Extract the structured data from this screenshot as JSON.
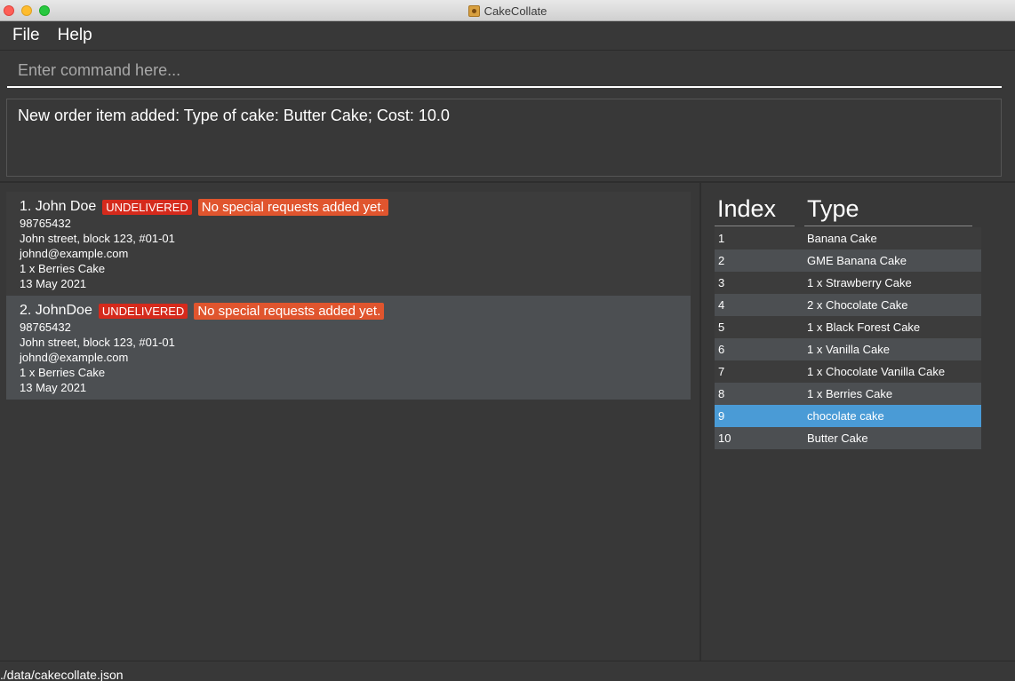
{
  "window": {
    "title": "CakeCollate"
  },
  "menu": {
    "file": "File",
    "help": "Help"
  },
  "command": {
    "placeholder": "Enter command here..."
  },
  "result": {
    "message": "New order item added: Type of cake: Butter Cake; Cost: 10.0"
  },
  "orders": [
    {
      "name": "1.  John Doe",
      "status": "UNDELIVERED",
      "request": "No special requests added yet.",
      "phone": "98765432",
      "address": "John street, block 123, #01-01",
      "email": "johnd@example.com",
      "items": "1 x Berries Cake",
      "date": "13 May 2021"
    },
    {
      "name": "2.  JohnDoe",
      "status": "UNDELIVERED",
      "request": "No special requests added yet.",
      "phone": "98765432",
      "address": "John street, block 123, #01-01",
      "email": "johnd@example.com",
      "items": "1 x Berries Cake",
      "date": "13 May 2021"
    }
  ],
  "order_items": {
    "headers": {
      "index": "Index",
      "type": "Type"
    },
    "selected_index": 8,
    "rows": [
      {
        "index": "1",
        "type": "Banana Cake"
      },
      {
        "index": "2",
        "type": "GME Banana Cake"
      },
      {
        "index": "3",
        "type": "1 x Strawberry Cake"
      },
      {
        "index": "4",
        "type": "2 x Chocolate Cake"
      },
      {
        "index": "5",
        "type": "1 x Black Forest Cake"
      },
      {
        "index": "6",
        "type": "1 x Vanilla Cake"
      },
      {
        "index": "7",
        "type": "1 x Chocolate Vanilla Cake"
      },
      {
        "index": "8",
        "type": "1 x Berries Cake"
      },
      {
        "index": "9",
        "type": "chocolate cake"
      },
      {
        "index": "10",
        "type": "Butter Cake"
      }
    ]
  },
  "status_bar": {
    "path": "./data/cakecollate.json"
  }
}
